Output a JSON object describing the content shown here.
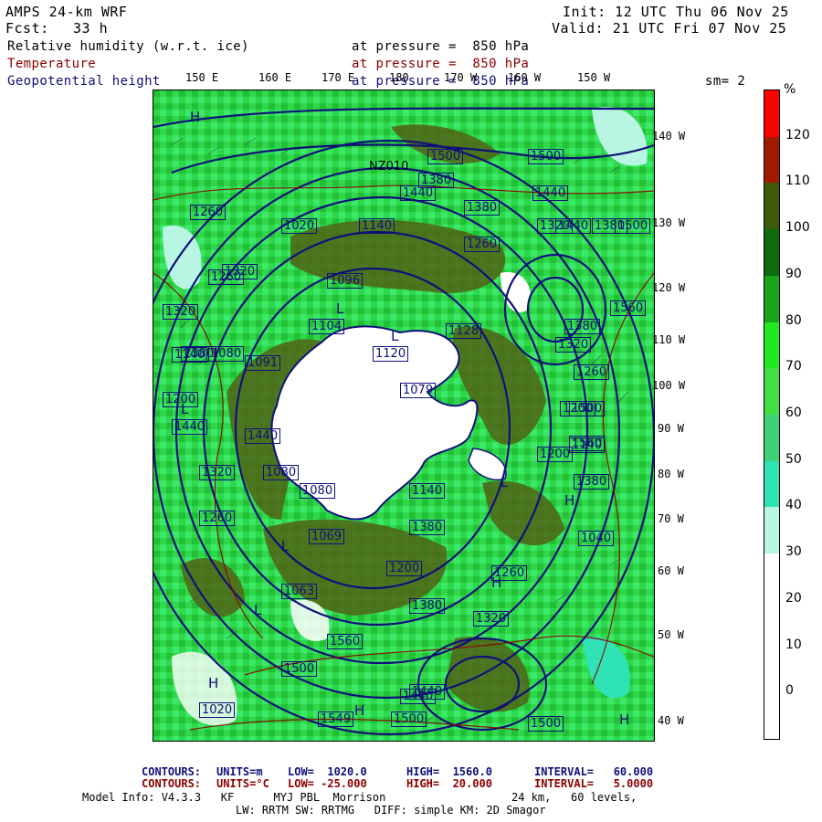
{
  "header": {
    "model": "AMPS 24-km WRF",
    "init": "Init: 12 UTC Thu 06 Nov 25",
    "fcst_label": "Fcst:",
    "fcst_value": "33 h",
    "valid": "Valid: 21 UTC Fri 07 Nov 25"
  },
  "fields": [
    {
      "name": "Relative humidity (w.r.t. ice)",
      "pressure": "at pressure =  850 hPa",
      "color": "#000000"
    },
    {
      "name": "Temperature",
      "pressure": "at pressure =  850 hPa",
      "color": "#8b0000"
    },
    {
      "name": "Geopotential height",
      "pressure": "at pressure =  850 hPa",
      "color": "#10107a"
    }
  ],
  "sm": "sm= 2",
  "longitude_top": [
    "150 E",
    "160 E",
    "170 E",
    "180",
    "170 W",
    "160 W",
    "150 W"
  ],
  "longitude_right": [
    "140 W",
    "130 W",
    "120 W",
    "110 W",
    "100 W",
    "90 W",
    "80 W",
    "70 W",
    "60 W",
    "50 W",
    "40 W"
  ],
  "colorbar": {
    "unit": "%",
    "ticks": [
      "120",
      "110",
      "100",
      "90",
      "80",
      "70",
      "60",
      "50",
      "40",
      "30",
      "20",
      "10",
      "0"
    ],
    "segments": [
      {
        "from": 120,
        "to": 130,
        "color": "#ff0000"
      },
      {
        "from": 110,
        "to": 120,
        "color": "#a11a00"
      },
      {
        "from": 100,
        "to": 110,
        "color": "#3e5a0c"
      },
      {
        "from": 90,
        "to": 100,
        "color": "#0e6a0e"
      },
      {
        "from": 80,
        "to": 90,
        "color": "#19a419"
      },
      {
        "from": 70,
        "to": 80,
        "color": "#22e822"
      },
      {
        "from": 60,
        "to": 70,
        "color": "#44dd44"
      },
      {
        "from": 50,
        "to": 60,
        "color": "#40d07a"
      },
      {
        "from": 40,
        "to": 50,
        "color": "#2fe3b4"
      },
      {
        "from": 30,
        "to": 40,
        "color": "#b9f5e3"
      },
      {
        "from": -10,
        "to": 30,
        "color": "#ffffff"
      }
    ]
  },
  "contour_labels": [
    "1500",
    "1500",
    "1440",
    "1440",
    "1380",
    "1380",
    "1320",
    "1260",
    "1200",
    "1140",
    "1080",
    "1020",
    "1140",
    "1260",
    "1320",
    "1380",
    "1440",
    "1500",
    "1560",
    "1380",
    "1320",
    "1260",
    "1200",
    "1140",
    "1080",
    "1080",
    "1063",
    "1069",
    "1079",
    "1091",
    "1096",
    "1104",
    "1120",
    "1128",
    "1140",
    "1200",
    "1260",
    "1320",
    "1380",
    "1440",
    "1500",
    "1440",
    "1380",
    "1320",
    "1260",
    "1020",
    "1040",
    "1200",
    "1380",
    "1549",
    "1500",
    "1440",
    "1500",
    "1560",
    "1380",
    "1440",
    "1320",
    "1260",
    "1500",
    "1560"
  ],
  "hl_markers": [
    "H",
    "H",
    "H",
    "L",
    "L",
    "L",
    "H",
    "H",
    "L",
    "L",
    "H",
    "L"
  ],
  "station_label": "NZ010",
  "contour_info": {
    "height": {
      "label": "CONTOURS:",
      "units": "UNITS=m",
      "low": "LOW=  1020.0",
      "high": "HIGH=  1560.0",
      "interval": "INTERVAL=   60.000"
    },
    "temp": {
      "label": "CONTOURS:",
      "units": "UNITS=°C",
      "low": "LOW= -25.000",
      "high": "HIGH=  20.000",
      "interval": "INTERVAL=   5.0000"
    }
  },
  "model_info": {
    "line1_left": "Model Info: V4.3.3   KF      MYJ PBL  Morrison",
    "line1_right": "24 km,   60 levels,",
    "line2": "LW: RRTM SW: RRTMG   DIFF: simple KM: 2D Smagor"
  }
}
